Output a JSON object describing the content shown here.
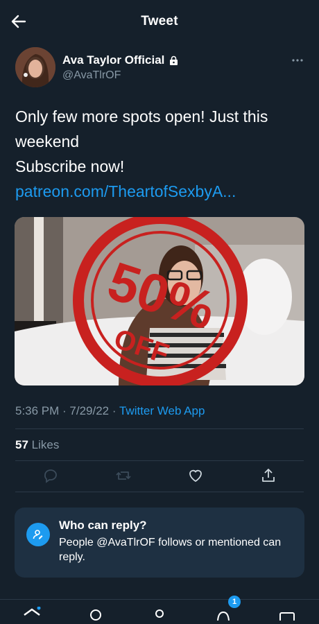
{
  "header": {
    "title": "Tweet"
  },
  "user": {
    "name": "Ava Taylor Official",
    "handle": "@AvaTlrOF"
  },
  "tweet": {
    "line1": "Only few more spots open! Just this",
    "line2": "weekend",
    "line3": "Subscribe now!",
    "link": "patreon.com/TheartofSexbyA..."
  },
  "media": {
    "badge_big": "50%",
    "badge_small": "OFF"
  },
  "meta": {
    "time": "5:36 PM",
    "date": "7/29/22",
    "separator1": " · ",
    "separator2": " · ",
    "source": "Twitter Web App"
  },
  "likes": {
    "count": "57",
    "label": " Likes"
  },
  "reply_settings": {
    "title": "Who can reply?",
    "description": "People @AvaTlrOF follows or mentioned can reply."
  },
  "nav": {
    "notifications_badge": "1"
  },
  "colors": {
    "background": "#15202b",
    "accent": "#1d9bf0",
    "secondary_text": "#8899a6",
    "card": "#1e3042"
  }
}
